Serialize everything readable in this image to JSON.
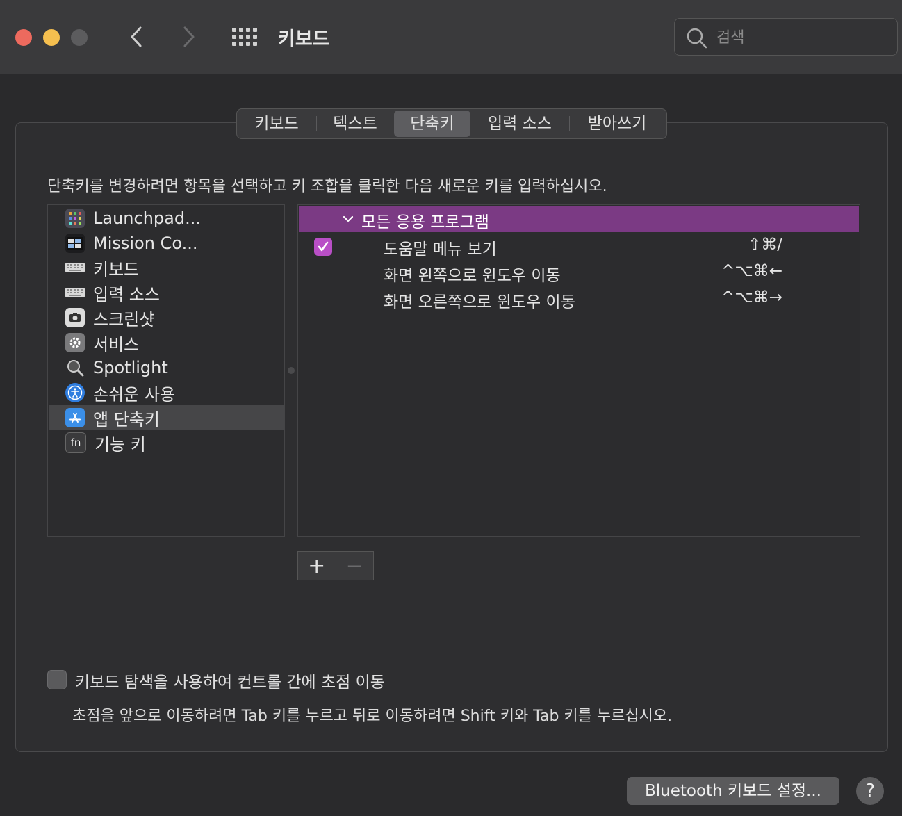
{
  "window": {
    "title": "키보드",
    "search_placeholder": "검색",
    "nav_back_icon": "chevron-left-icon",
    "nav_forward_icon": "chevron-right-icon",
    "show_all_icon": "grid-icon"
  },
  "tabs": [
    {
      "label": "키보드",
      "active": false
    },
    {
      "label": "텍스트",
      "active": false
    },
    {
      "label": "단축키",
      "active": true
    },
    {
      "label": "입력 소스",
      "active": false
    },
    {
      "label": "받아쓰기",
      "active": false
    }
  ],
  "instruction": "단축키를 변경하려면 항목을 선택하고 키 조합을 클릭한 다음 새로운 키를 입력하십시오.",
  "categories": [
    {
      "label": "Launchpad...",
      "icon": "launchpad-icon",
      "selected": false
    },
    {
      "label": "Mission Co...",
      "icon": "mission-control-icon",
      "selected": false
    },
    {
      "label": "키보드",
      "icon": "keyboard-icon",
      "selected": false
    },
    {
      "label": "입력 소스",
      "icon": "keyboard-icon",
      "selected": false
    },
    {
      "label": "스크린샷",
      "icon": "screenshot-icon",
      "selected": false
    },
    {
      "label": "서비스",
      "icon": "gear-icon",
      "selected": false
    },
    {
      "label": "Spotlight",
      "icon": "magnifier-icon",
      "selected": false
    },
    {
      "label": "손쉬운 사용",
      "icon": "accessibility-icon",
      "selected": false
    },
    {
      "label": "앱 단축키",
      "icon": "app-store-icon",
      "selected": true
    },
    {
      "label": "기능 키",
      "icon": "fn-icon",
      "selected": false
    }
  ],
  "shortcuts": {
    "group_label": "모든 응용 프로그램",
    "items": [
      {
        "label": "도움말 메뉴 보기",
        "keys": "⇧⌘/",
        "checked": true
      },
      {
        "label": "화면 왼쪽으로 윈도우 이동",
        "keys": "^⌥⌘←",
        "checked": null
      },
      {
        "label": "화면 오른쪽으로 윈도우 이동",
        "keys": "^⌥⌘→",
        "checked": null
      }
    ]
  },
  "buttons": {
    "add": "+",
    "remove": "−",
    "bluetooth": "Bluetooth 키보드 설정...",
    "help": "?"
  },
  "keyboard_navigation": {
    "label": "키보드 탐색을 사용하여 컨트롤 간에 초점 이동",
    "checked": false,
    "description": "초점을 앞으로 이동하려면 Tab 키를 누르고 뒤로 이동하려면 Shift 키와 Tab 키를 누르십시오."
  },
  "colors": {
    "accent": "#b94fc6",
    "selection_row": "#7b3a84"
  }
}
